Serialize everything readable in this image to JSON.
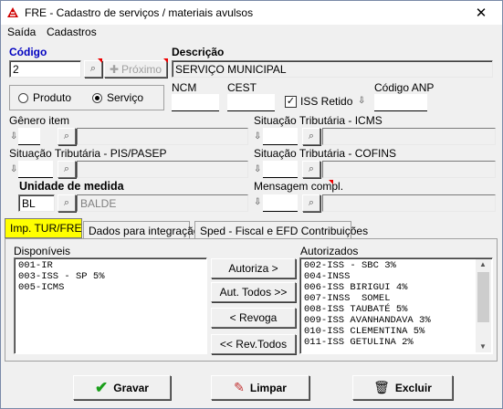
{
  "window": {
    "title": "FRE - Cadastro de serviços / materiais avulsos",
    "accent": "#d00000"
  },
  "menu": {
    "items": [
      "Saída",
      "Cadastros"
    ]
  },
  "codigo": {
    "label": "Código",
    "value": "2",
    "proximo_label": "Próximo"
  },
  "descricao": {
    "label": "Descrição",
    "value": "SERVIÇO MUNICIPAL"
  },
  "tipo": {
    "produto_label": "Produto",
    "servico_label": "Serviço",
    "selected": "Serviço"
  },
  "ncm": {
    "label": "NCM",
    "value": ""
  },
  "cest": {
    "label": "CEST",
    "value": ""
  },
  "iss_retido": {
    "label": "ISS Retido",
    "checked": true
  },
  "codigo_anp": {
    "label": "Código ANP",
    "value": ""
  },
  "genero_item": {
    "label": "Gênero item",
    "value": ""
  },
  "situacao_icms": {
    "label": "Situação Tributária - ICMS",
    "value": ""
  },
  "situacao_pis": {
    "label": "Situação Tributária - PIS/PASEP",
    "value": ""
  },
  "situacao_cofins": {
    "label": "Situação Tributária - COFINS",
    "value": ""
  },
  "unidade": {
    "label": "Unidade de medida",
    "code": "BL",
    "description": "BALDE"
  },
  "mensagem": {
    "label": "Mensagem compl.",
    "value": ""
  },
  "tabs": {
    "items": [
      "Imp. TUR/FRE",
      "Dados para integração",
      "Sped - Fiscal e EFD Contribuições"
    ],
    "active": "Imp. TUR/FRE"
  },
  "disponiveis": {
    "label": "Disponíveis",
    "items": [
      "001-IR",
      "003-ISS - SP 5%",
      "005-ICMS"
    ]
  },
  "autorizados": {
    "label": "Autorizados",
    "items": [
      "002-ISS - SBC 3%",
      "004-INSS",
      "006-ISS BIRIGUI 4%",
      "007-INSS  SOMEL",
      "008-ISS TAUBATÉ 5%",
      "009-ISS AVANHANDAVA 3%",
      "010-ISS CLEMENTINA 5%",
      "011-ISS GETULINA 2%"
    ]
  },
  "transfer_buttons": {
    "autoriza": "Autoriza >",
    "aut_todos": "Aut. Todos >>",
    "revoga": "< Revoga",
    "rev_todos": "<< Rev.Todos"
  },
  "footer": {
    "gravar": "Gravar",
    "limpar": "Limpar",
    "excluir": "Excluir"
  }
}
